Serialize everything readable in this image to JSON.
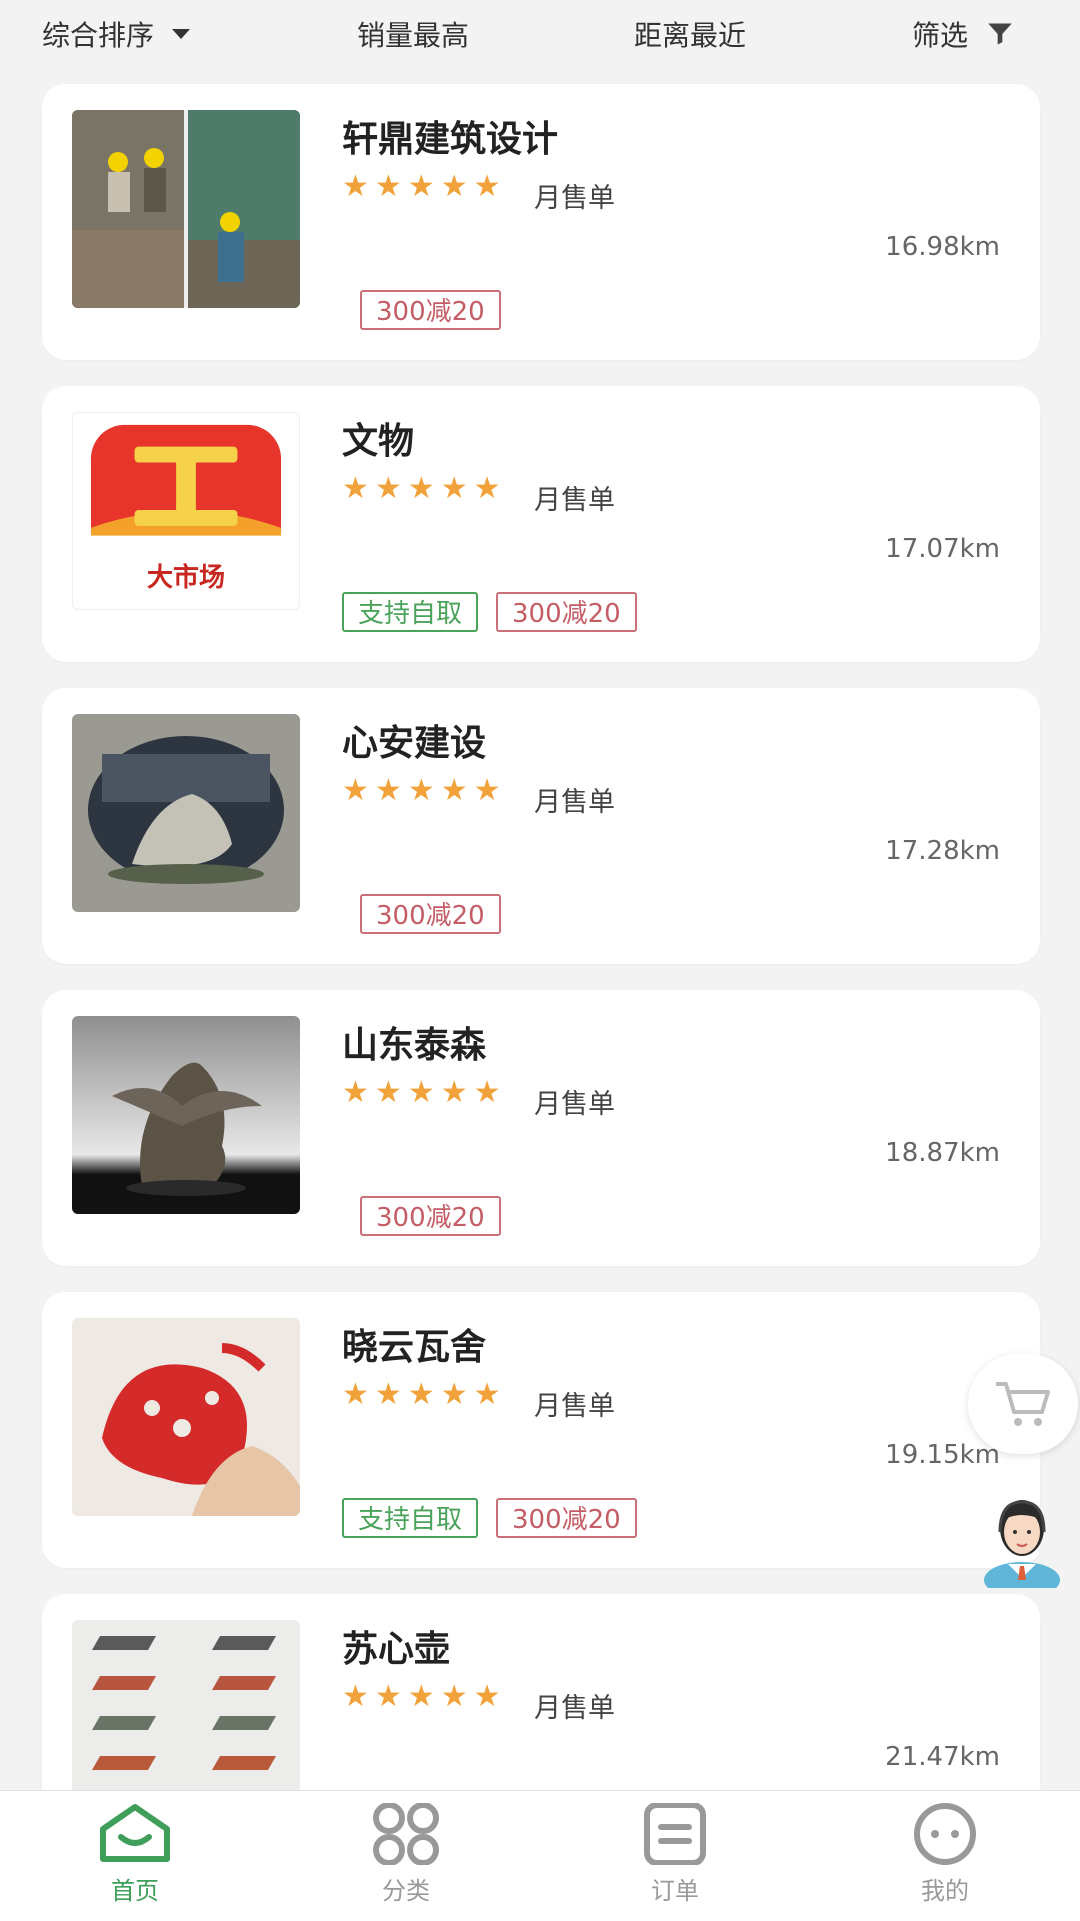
{
  "sort_bar": {
    "comprehensive": "综合排序",
    "sales": "销量最高",
    "distance": "距离最近",
    "filter": "筛选"
  },
  "shops": [
    {
      "name": "轩鼎建筑设计",
      "sales_label": "月售单",
      "distance": "16.98km",
      "rating": 5,
      "tags": [
        "300减20"
      ],
      "image": "construction-workers"
    },
    {
      "name": "文物",
      "sales_label": "月售单",
      "distance": "17.07km",
      "rating": 5,
      "tags": [
        "支持自取",
        "300减20"
      ],
      "image": "market-logo",
      "logo_text": "大市场"
    },
    {
      "name": "心安建设",
      "sales_label": "月售单",
      "distance": "17.28km",
      "rating": 5,
      "tags": [
        "300减20"
      ],
      "image": "round-window-rockery"
    },
    {
      "name": "山东泰森",
      "sales_label": "月售单",
      "distance": "18.87km",
      "rating": 5,
      "tags": [
        "300减20"
      ],
      "image": "bronze-sculpture"
    },
    {
      "name": "晓云瓦舍",
      "sales_label": "月售单",
      "distance": "19.15km",
      "rating": 5,
      "tags": [
        "支持自取",
        "300减20"
      ],
      "image": "paper-cutting"
    },
    {
      "name": "苏心壶",
      "sales_label": "月售单",
      "distance": "21.47km",
      "rating": 5,
      "tags": [],
      "image": "roof-tiles"
    }
  ],
  "tab_bar": {
    "home": "首页",
    "category": "分类",
    "orders": "订单",
    "mine": "我的"
  },
  "colors": {
    "accent_green": "#3f9e5a",
    "star": "#f2a23b",
    "discount_red": "#c45d66"
  },
  "floating": {
    "cart": "cart-icon",
    "agent": "customer-service-icon"
  }
}
